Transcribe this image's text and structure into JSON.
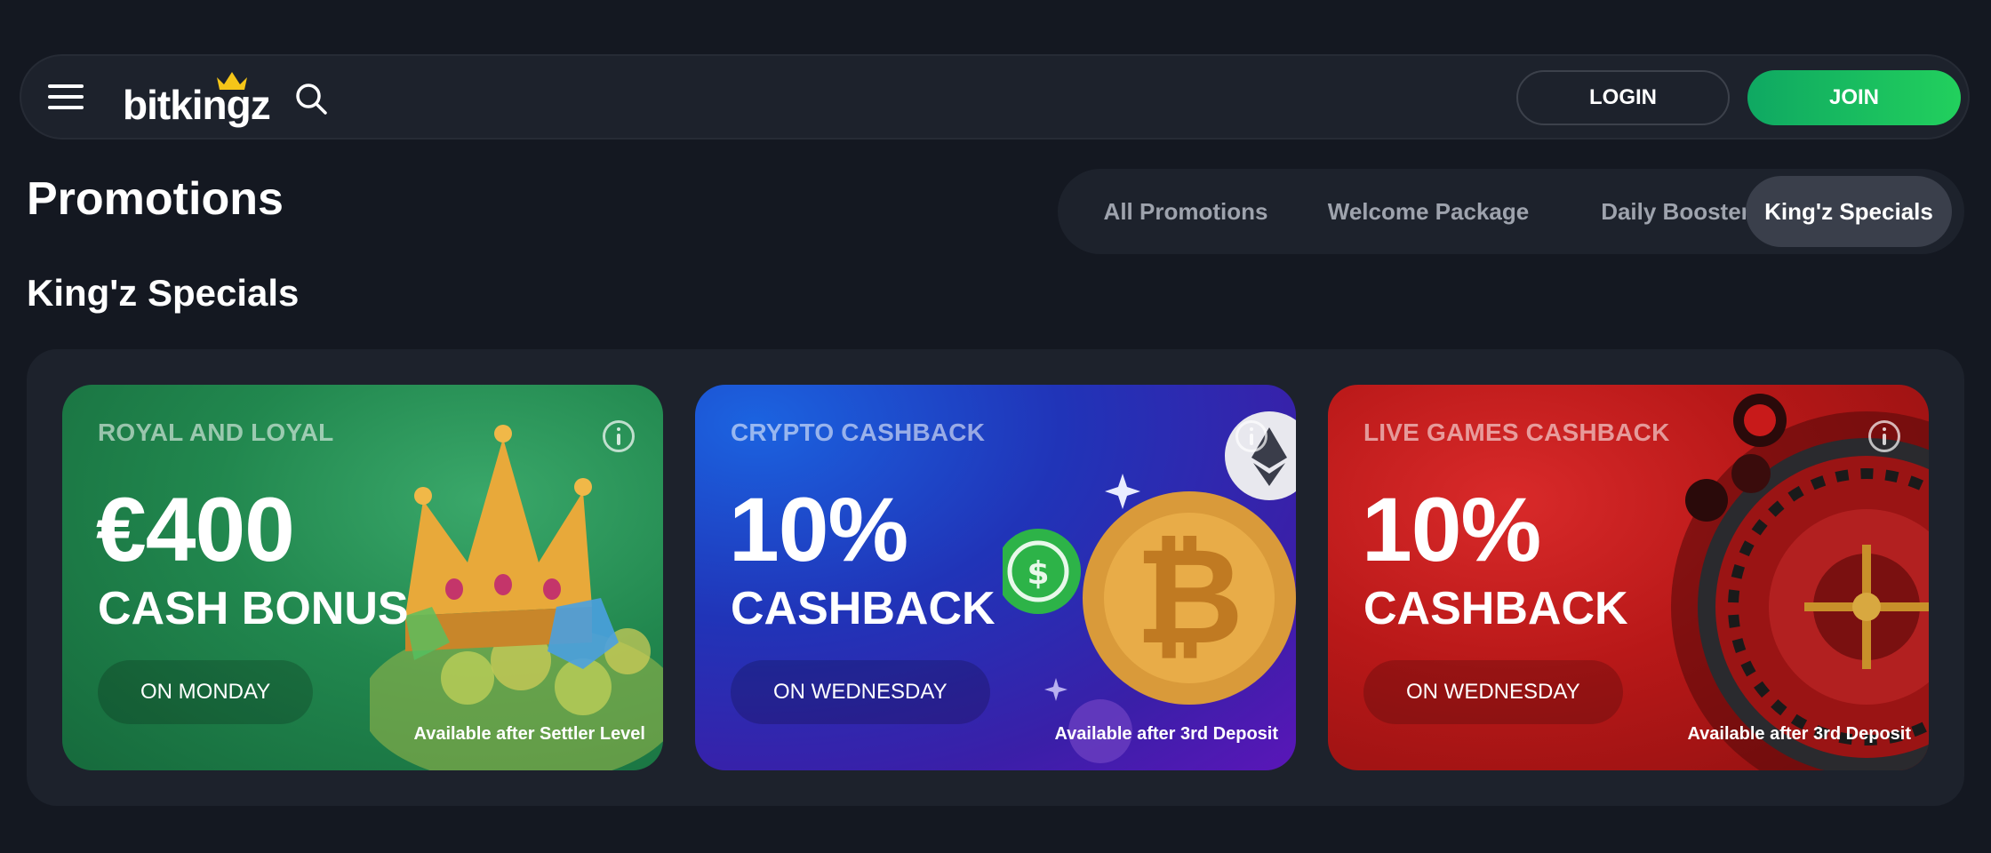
{
  "header": {
    "logo_text": "bitkingz",
    "login_label": "LOGIN",
    "join_label": "JOIN",
    "icons": [
      "menu-icon",
      "search-icon"
    ]
  },
  "page": {
    "title": "Promotions",
    "section_title": "King'z Specials"
  },
  "tabs": [
    {
      "label": "All Promotions",
      "active": false
    },
    {
      "label": "Welcome Package",
      "active": false
    },
    {
      "label": "Daily Booster",
      "active": false
    },
    {
      "label": "King'z Specials",
      "active": true
    }
  ],
  "cards": [
    {
      "eyebrow": "ROYAL AND LOYAL",
      "amount": "€400",
      "subtitle": "CASH BONUS",
      "day": "ON MONDAY",
      "availability": "Available after Settler Level",
      "theme": "#21874e",
      "art": "crown-and-coins"
    },
    {
      "eyebrow": "CRYPTO CASHBACK",
      "amount": "10%",
      "subtitle": "CASHBACK",
      "day": "ON WEDNESDAY",
      "availability": "Available after 3rd Deposit",
      "theme": "#2034b8",
      "art": "crypto-coins"
    },
    {
      "eyebrow": "LIVE GAMES CASHBACK",
      "amount": "10%",
      "subtitle": "CASHBACK",
      "day": "ON WEDNESDAY",
      "availability": "Available after 3rd Deposit",
      "theme": "#b81818",
      "art": "roulette-wheel"
    }
  ],
  "colors": {
    "background": "#141821",
    "panel": "#1d222c",
    "join_green": "#22d05d",
    "active_tab": "#3a3f4b"
  }
}
